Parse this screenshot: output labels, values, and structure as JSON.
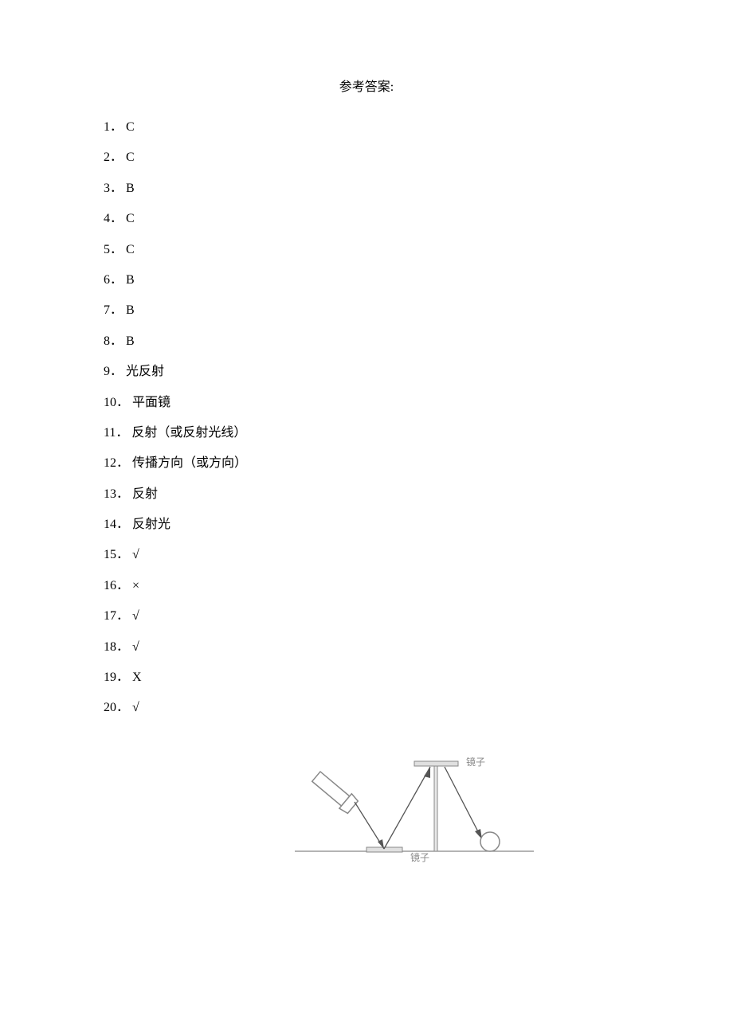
{
  "title": "参考答案:",
  "answers": [
    {
      "n": "1．",
      "v": "C"
    },
    {
      "n": "2．",
      "v": "C"
    },
    {
      "n": "3．",
      "v": "B"
    },
    {
      "n": "4．",
      "v": "C"
    },
    {
      "n": "5．",
      "v": "C"
    },
    {
      "n": "6．",
      "v": "B"
    },
    {
      "n": "7．",
      "v": "B"
    },
    {
      "n": "8．",
      "v": "B"
    },
    {
      "n": "9．",
      "v": "光反射"
    },
    {
      "n": "10．",
      "v": "平面镜"
    },
    {
      "n": "11．",
      "v": "反射（或反射光线）"
    },
    {
      "n": "12．",
      "v": "传播方向（或方向）"
    },
    {
      "n": "13．",
      "v": "反射"
    },
    {
      "n": "14．",
      "v": "反射光"
    },
    {
      "n": "15．",
      "v": "√"
    },
    {
      "n": "16．",
      "v": "×"
    },
    {
      "n": "17．",
      "v": "√"
    },
    {
      "n": "18．",
      "v": "√"
    },
    {
      "n": "19．",
      "v": "X"
    },
    {
      "n": "20．",
      "v": "√"
    }
  ],
  "figure": {
    "label_top_mirror": "镜子",
    "label_bottom_mirror": "镜子"
  }
}
